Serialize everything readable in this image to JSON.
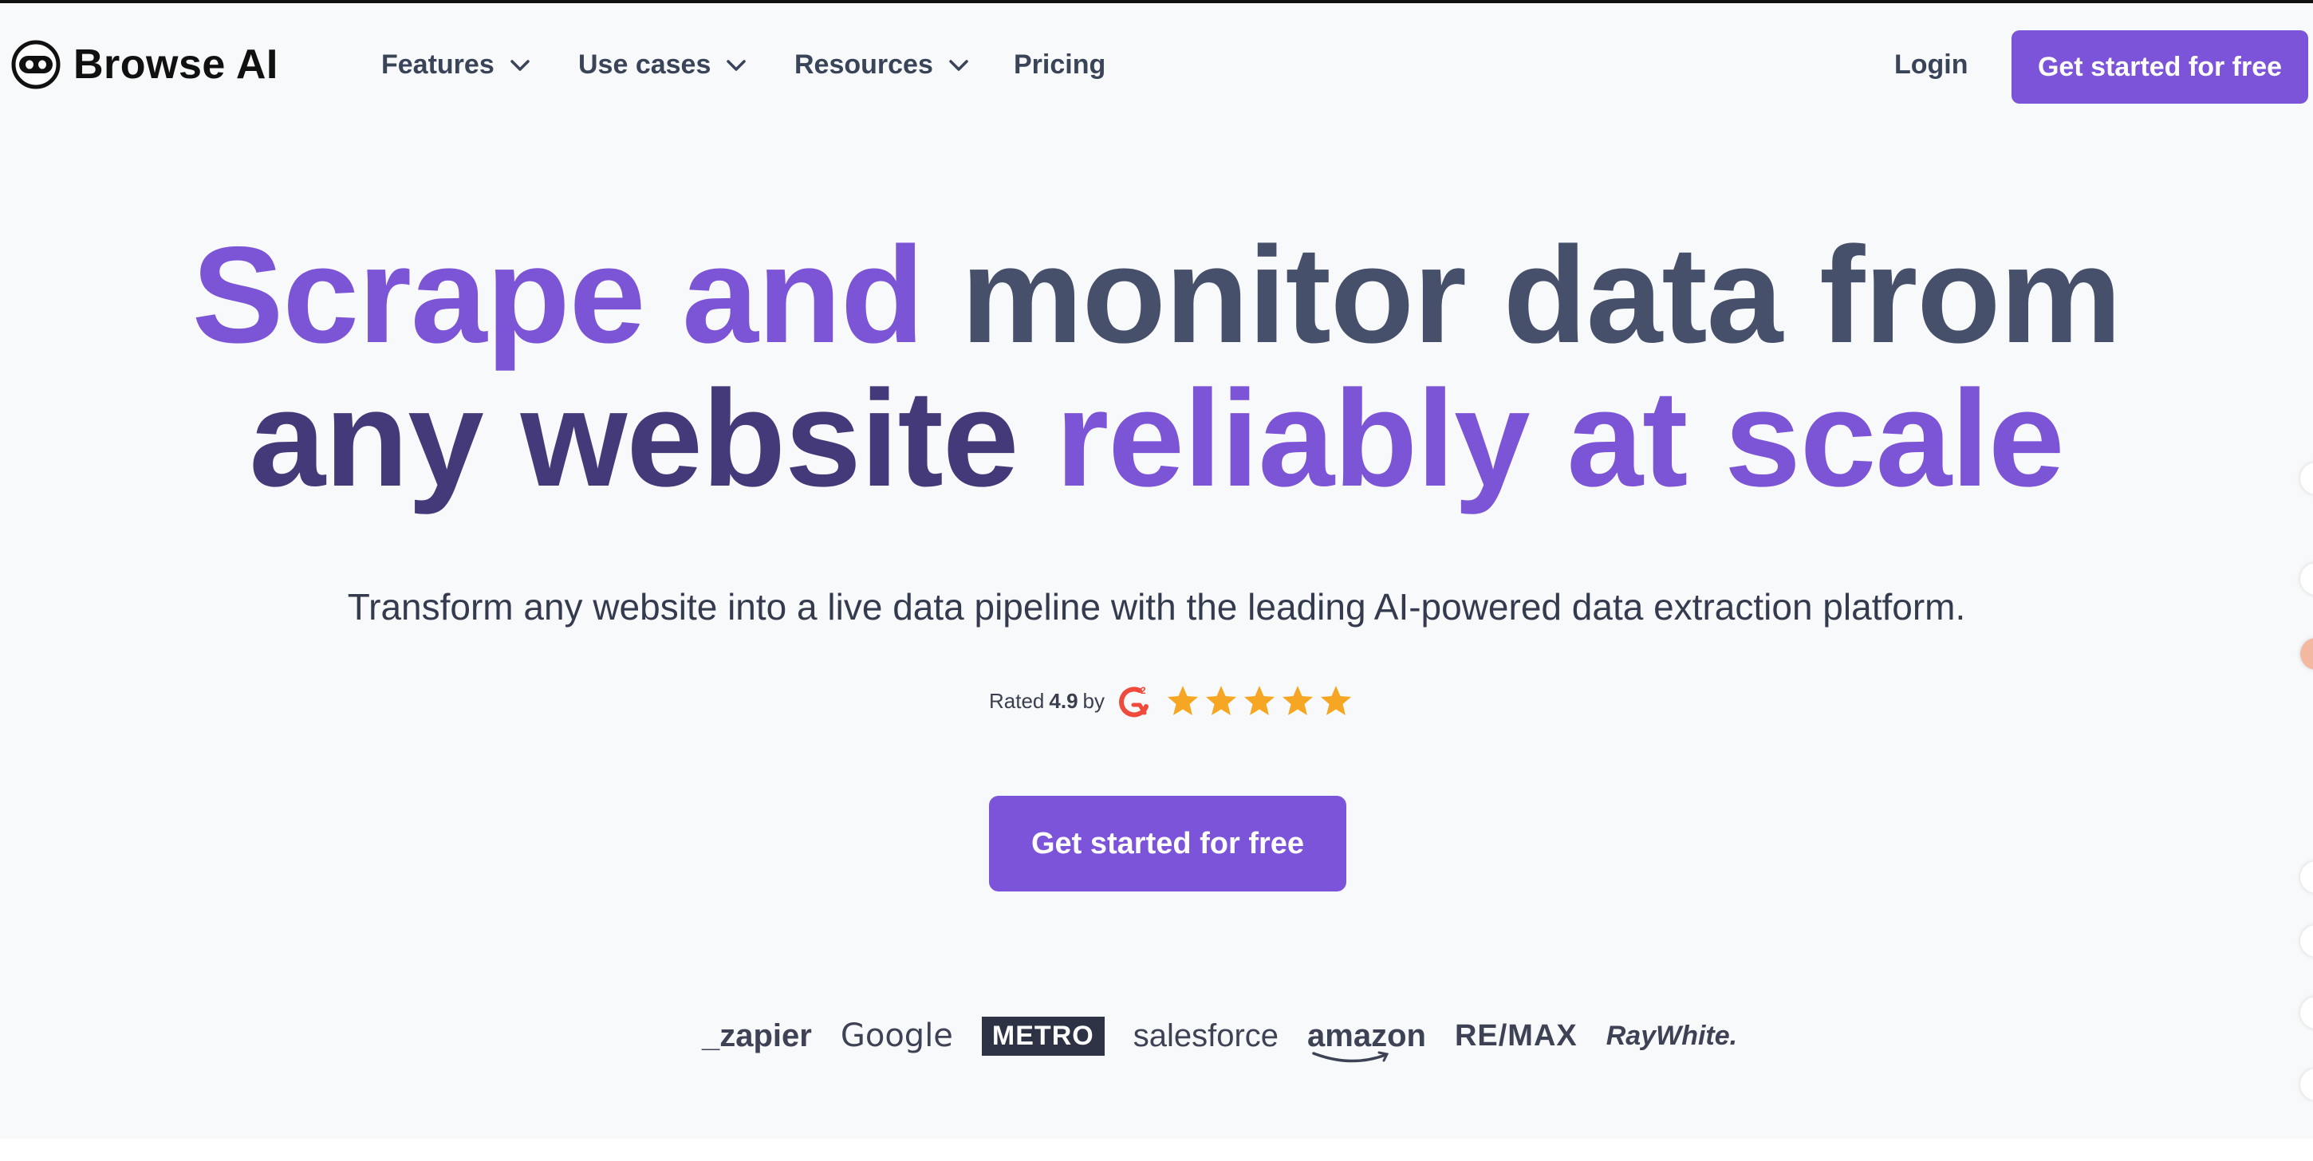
{
  "brand": {
    "name": "Browse AI",
    "logo_icon": "robot-face-icon"
  },
  "nav": {
    "items": [
      {
        "label": "Features",
        "has_dropdown": true
      },
      {
        "label": "Use cases",
        "has_dropdown": true
      },
      {
        "label": "Resources",
        "has_dropdown": true
      },
      {
        "label": "Pricing",
        "has_dropdown": false
      }
    ],
    "login_label": "Login",
    "cta_label": "Get started for free"
  },
  "hero": {
    "headline_line1": [
      {
        "text": "Scrape ",
        "tone": "purple"
      },
      {
        "text": "and ",
        "tone": "purple"
      },
      {
        "text": "monitor data from",
        "tone": "slate"
      }
    ],
    "headline_line2": [
      {
        "text": "any website ",
        "tone": "deep"
      },
      {
        "text": "reliably at scale",
        "tone": "purple"
      }
    ],
    "subhead": "Transform any website into a live data pipeline with the leading AI-powered data extraction platform.",
    "rating": {
      "prefix": "Rated",
      "score": "4.9",
      "suffix": "by",
      "source_icon": "g2-logo-icon",
      "stars": 5
    },
    "cta_label": "Get started for free"
  },
  "customer_logos": [
    "_zapier",
    "Google",
    "METRO",
    "salesforce",
    "amazon",
    "RE/MAX",
    "RayWhite."
  ],
  "colors": {
    "accent": "#7b54d9",
    "purple_text": "#7c55d6",
    "slate_text": "#47506a",
    "deep_text": "#453a79",
    "star": "#f5a623",
    "g2": "#ef4a3b",
    "background": "#f8f9fb"
  }
}
